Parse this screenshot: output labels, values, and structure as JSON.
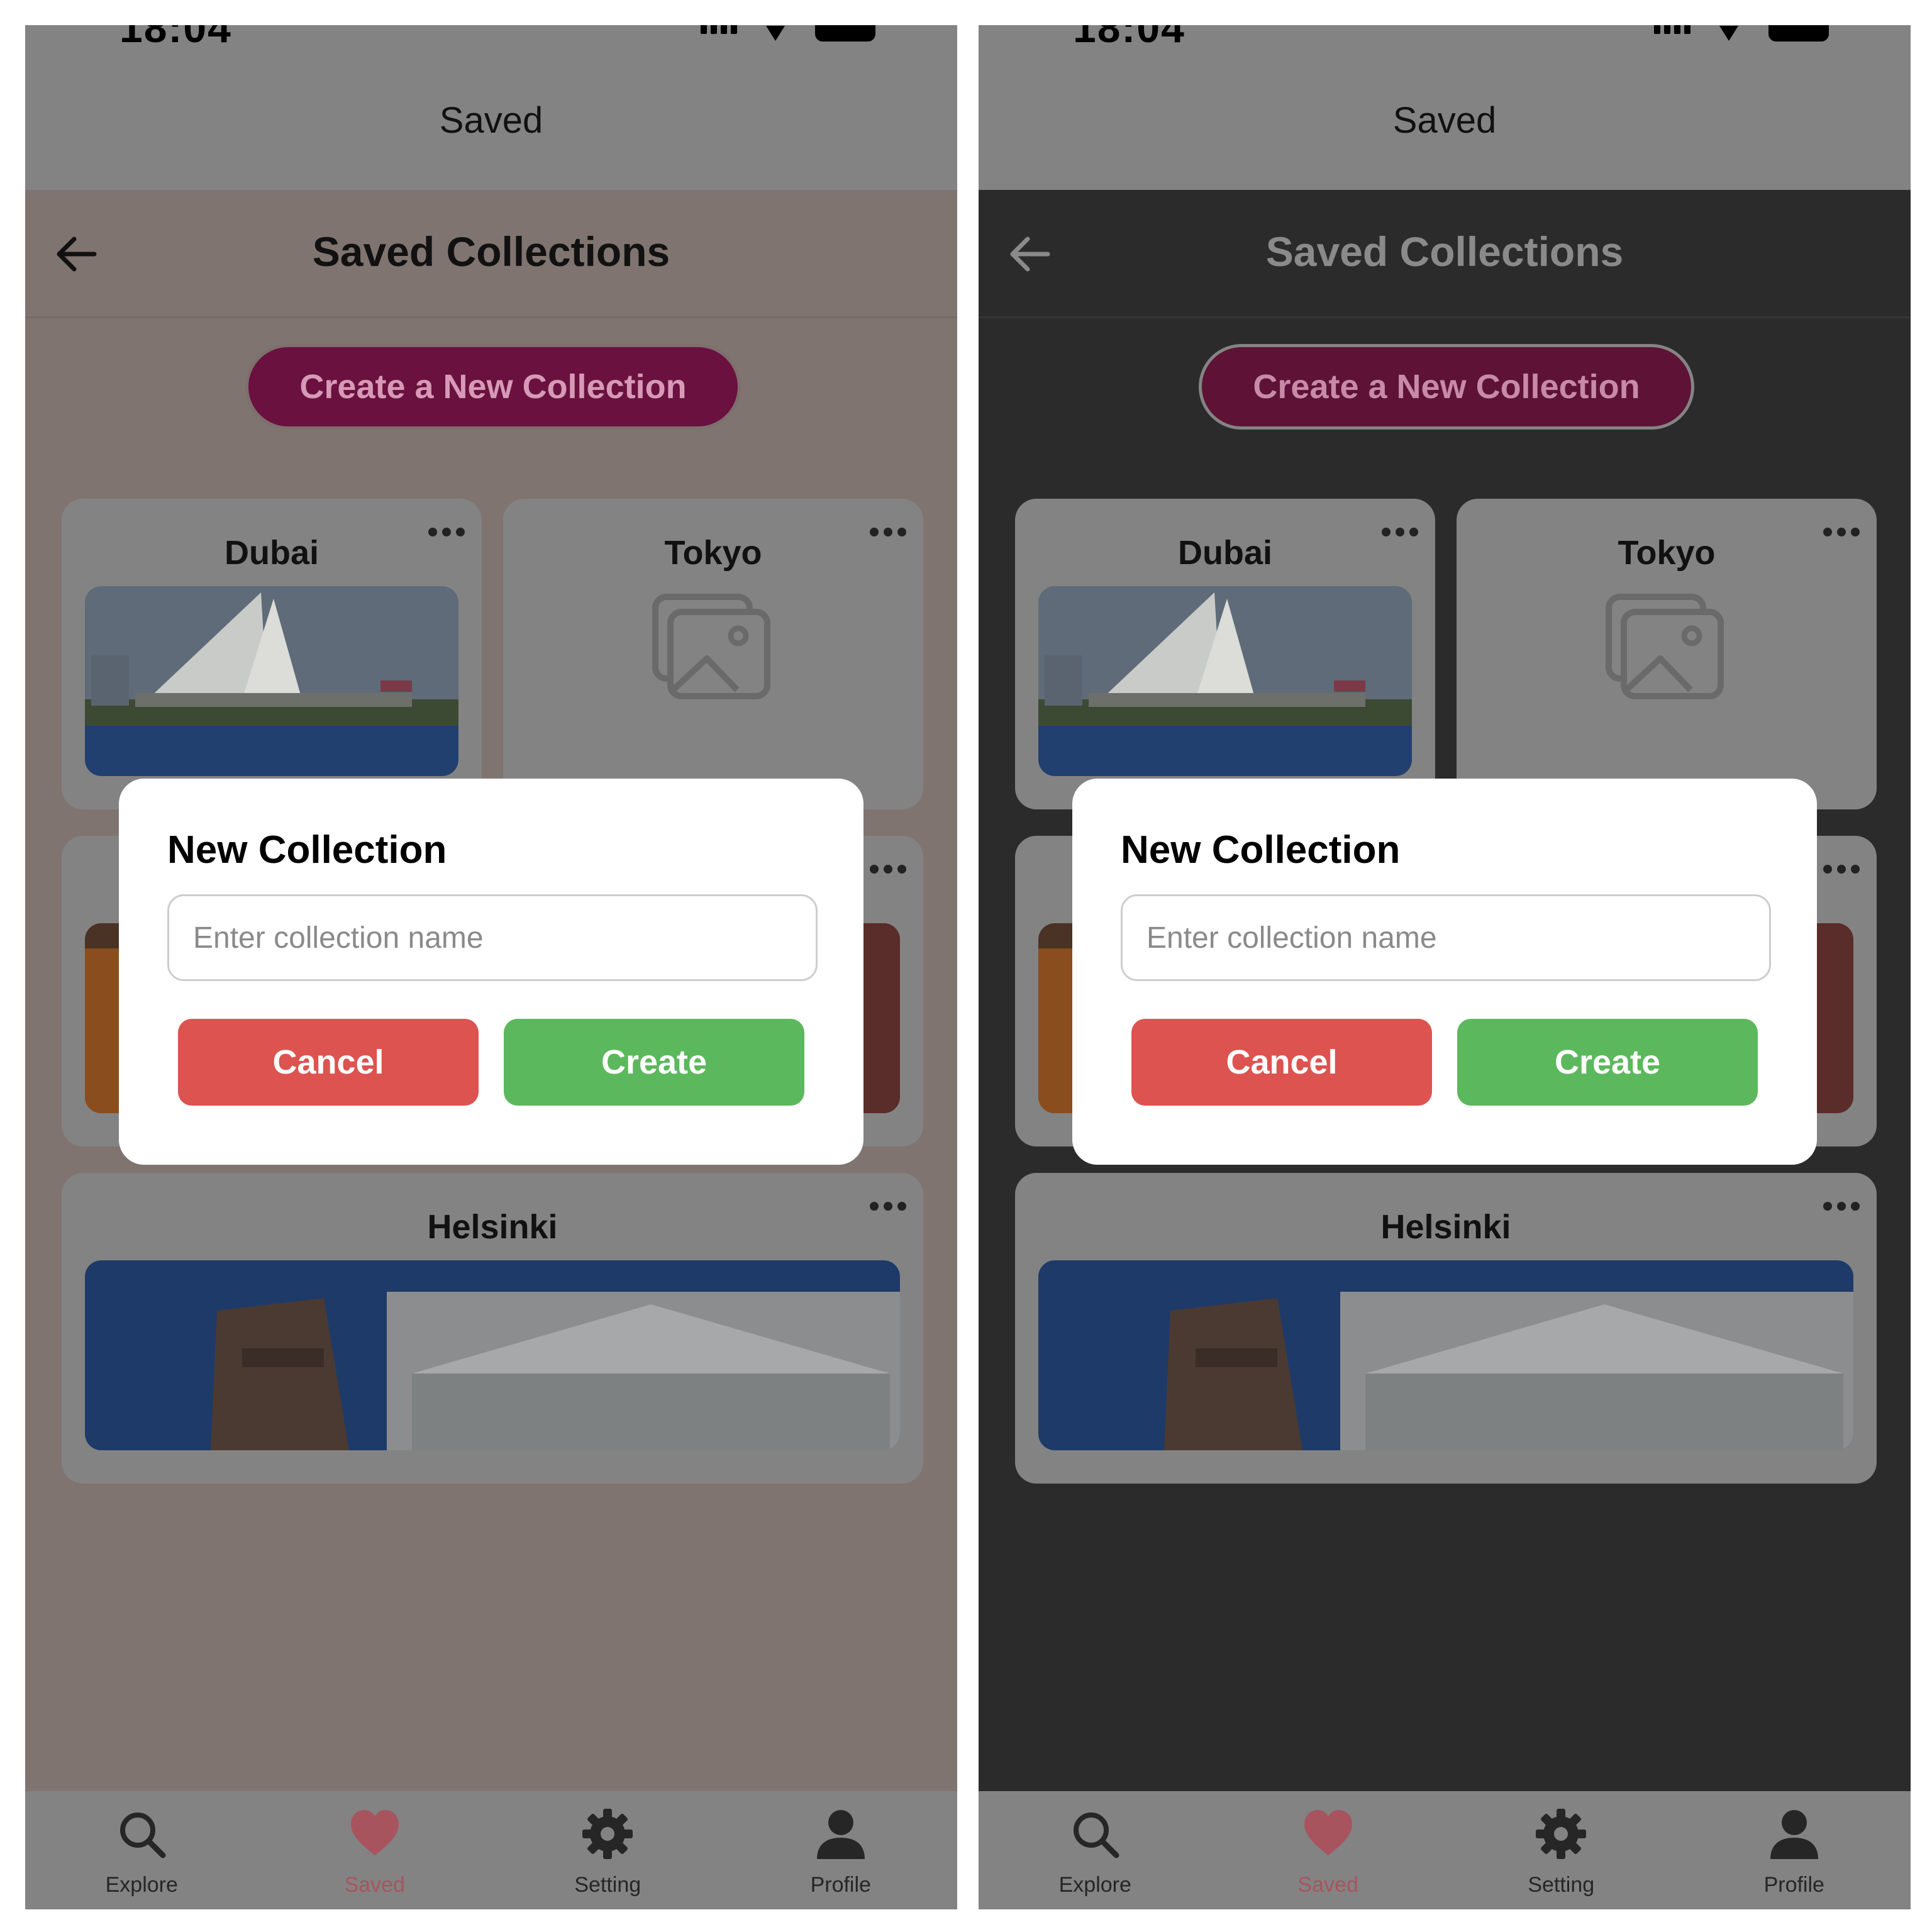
{
  "status_bar": {
    "time": "18:04"
  },
  "top_bar": {
    "title": "Saved"
  },
  "header": {
    "title": "Saved Collections"
  },
  "create_button": {
    "label": "Create a New Collection"
  },
  "collections": [
    {
      "name": "Dubai",
      "has_image": true
    },
    {
      "name": "Tokyo",
      "has_image": false
    },
    {
      "name": "",
      "has_image": true
    },
    {
      "name": "Helsinki",
      "has_image": true
    }
  ],
  "modal": {
    "title": "New Collection",
    "input_placeholder": "Enter collection name",
    "input_value": "",
    "cancel_label": "Cancel",
    "create_label": "Create"
  },
  "nav": {
    "items": [
      {
        "label": "Explore",
        "icon": "search-icon"
      },
      {
        "label": "Saved",
        "icon": "heart-icon",
        "active": true
      },
      {
        "label": "Setting",
        "icon": "gear-icon"
      },
      {
        "label": "Profile",
        "icon": "person-icon"
      }
    ]
  },
  "themes": {
    "left": {
      "overlay_bg": "#807470"
    },
    "right": {
      "overlay_bg": "#2b2b2b"
    }
  },
  "colors": {
    "brand": "#6a1140",
    "cancel": "#dd5350",
    "create": "#5cb85c",
    "active_nav": "#a8545f"
  }
}
